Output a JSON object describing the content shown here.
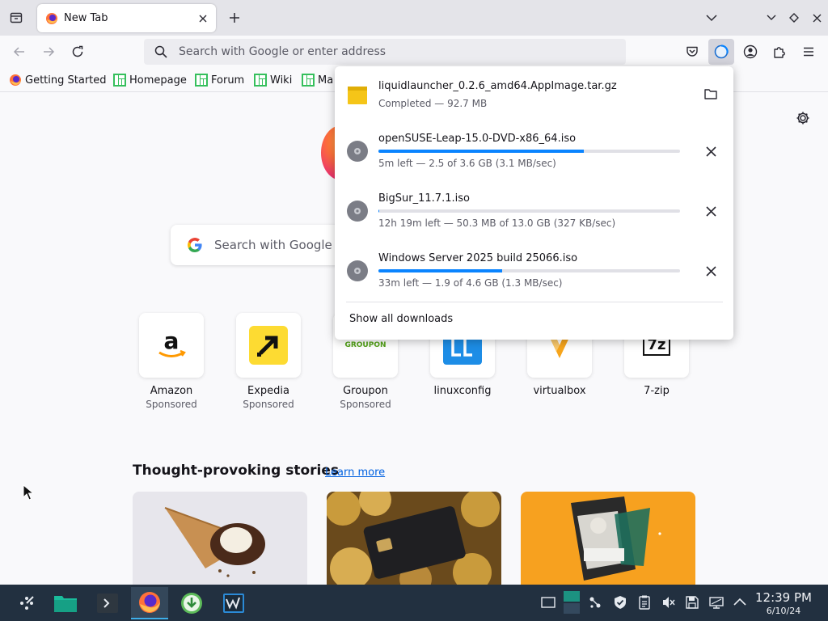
{
  "tab": {
    "title": "New Tab"
  },
  "urlbar": {
    "placeholder": "Search with Google or enter address"
  },
  "bookmarks": [
    {
      "label": "Getting Started"
    },
    {
      "label": "Homepage"
    },
    {
      "label": "Forum"
    },
    {
      "label": "Wiki"
    },
    {
      "label": "Ma"
    }
  ],
  "newtab": {
    "search_placeholder": "Search with Google o",
    "shortcuts": [
      {
        "name": "Amazon",
        "sponsored": "Sponsored"
      },
      {
        "name": "Expedia",
        "sponsored": "Sponsored"
      },
      {
        "name": "Groupon",
        "sponsored": "Sponsored",
        "logo_text": "GROUPON"
      },
      {
        "name": "linuxconfig"
      },
      {
        "name": "virtualbox"
      },
      {
        "name": "7-zip",
        "logo_text": "7z"
      }
    ],
    "stories_heading": "Thought-provoking stories",
    "learn_more": "Learn more"
  },
  "downloads": {
    "items": [
      {
        "filename": "liquidlauncher_0.2.6_amd64.AppImage.tar.gz",
        "status": "Completed — 92.7 MB",
        "progress": null
      },
      {
        "filename": "openSUSE-Leap-15.0-DVD-x86_64.iso",
        "status": "5m left — 2.5 of 3.6 GB (3.1 MB/sec)",
        "progress": 0.68
      },
      {
        "filename": "BigSur_11.7.1.iso",
        "status": "12h 19m left — 50.3 MB of 13.0 GB (327 KB/sec)",
        "progress": 0.004
      },
      {
        "filename": "Windows Server 2025 build 25066.iso",
        "status": "33m left — 1.9 of 4.6 GB (1.3 MB/sec)",
        "progress": 0.41
      }
    ],
    "show_all": "Show all downloads"
  },
  "taskbar": {
    "time": "12:39 PM",
    "date": "6/10/24"
  },
  "colors": {
    "accent": "#0a84ff",
    "taskbar": "#223040",
    "link": "#0061e0"
  }
}
